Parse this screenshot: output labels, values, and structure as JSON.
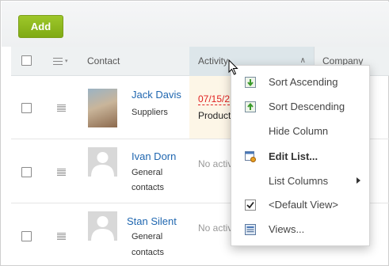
{
  "toolbar": {
    "add_label": "Add"
  },
  "grid": {
    "headers": {
      "contact": "Contact",
      "activity": "Activity",
      "company": "Company"
    },
    "rows": [
      {
        "name": "Jack Davis",
        "type_line1": "Suppliers",
        "type_line2": "",
        "activity_date": "07/15/2",
        "activity_text": "Product",
        "avatar": "photo"
      },
      {
        "name": "Ivan Dorn",
        "type_line1": "General",
        "type_line2": "contacts",
        "activity_none": "No activ",
        "avatar": "blank"
      },
      {
        "name": "Stan Silent",
        "type_line1": "General",
        "type_line2": "contacts",
        "activity_none": "No activ",
        "avatar": "blank"
      }
    ]
  },
  "column_menu": {
    "items": [
      {
        "label": "Sort Ascending",
        "icon": "sort-ascending-icon"
      },
      {
        "label": "Sort Descending",
        "icon": "sort-descending-icon"
      },
      {
        "label": "Hide Column",
        "icon": ""
      },
      {
        "label": "Edit List...",
        "icon": "edit-list-icon"
      },
      {
        "label": "List Columns",
        "icon": "",
        "submenu": true
      },
      {
        "label": "<Default View>",
        "icon": "checkmark-icon",
        "checked": true
      },
      {
        "label": "Views...",
        "icon": "views-icon"
      }
    ]
  },
  "colors": {
    "add_button": "#8ab81c",
    "link": "#2067b0",
    "overdue_date": "#e02020",
    "activity_highlight": "#fdf6e7"
  }
}
